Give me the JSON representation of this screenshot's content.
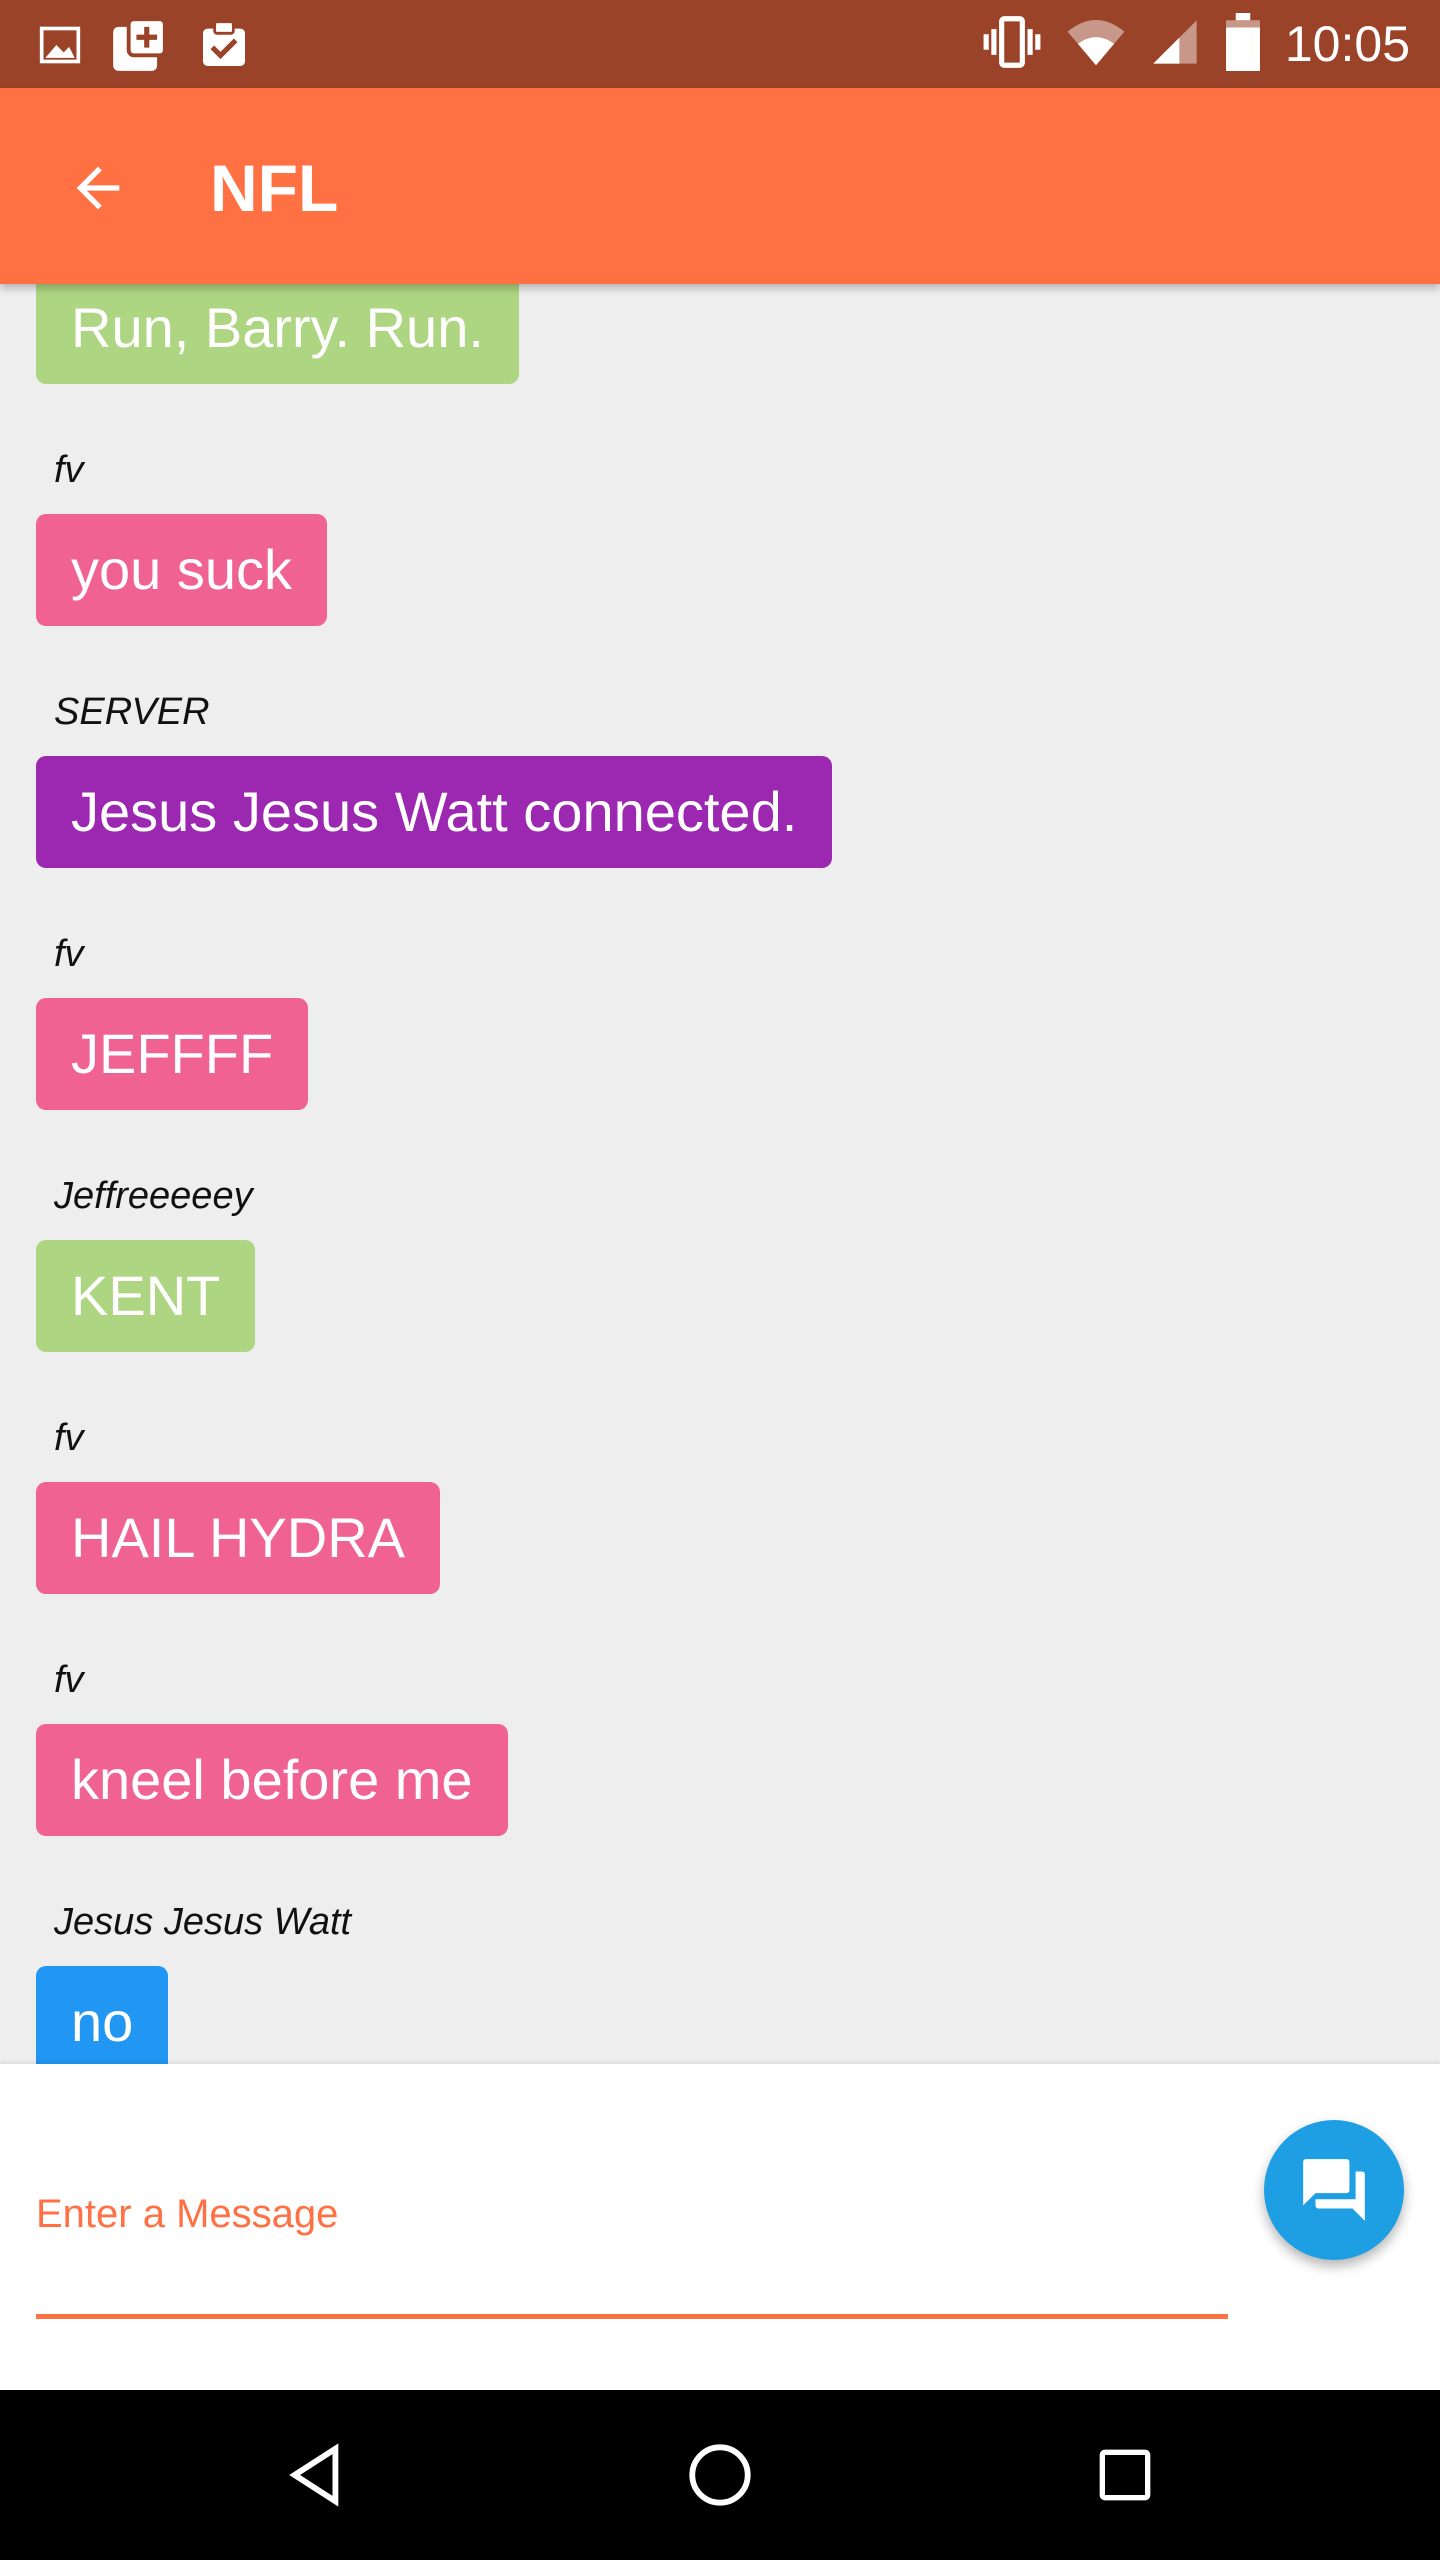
{
  "status_bar": {
    "time": "10:05",
    "left_icons": [
      "image-icon",
      "photos-plus-icon",
      "clipboard-check-icon"
    ],
    "right_icons": [
      "vibrate-icon",
      "wifi-icon",
      "signal-icon",
      "battery-icon"
    ]
  },
  "toolbar": {
    "title": "NFL",
    "back_icon": "arrow-back-icon",
    "color": "#ff7043"
  },
  "messages": [
    {
      "sender": "",
      "text": "Run, Barry. Run.",
      "color": "#aed581"
    },
    {
      "sender": "fv",
      "text": "you suck",
      "color": "#f06292"
    },
    {
      "sender": "SERVER",
      "text": "Jesus Jesus Watt connected.",
      "color": "#9c27b0"
    },
    {
      "sender": "fv",
      "text": "JEFFFF",
      "color": "#f06292"
    },
    {
      "sender": "Jeffreeeeey",
      "text": "KENT",
      "color": "#aed581"
    },
    {
      "sender": "fv",
      "text": "HAIL HYDRA",
      "color": "#f06292"
    },
    {
      "sender": "fv",
      "text": "kneel before me",
      "color": "#f06292"
    },
    {
      "sender": "Jesus Jesus Watt",
      "text": "no",
      "color": "#2196f3"
    }
  ],
  "composer": {
    "placeholder": "Enter a Message",
    "send_icon": "chat-bubbles-icon",
    "fab_color": "#1e9ee3"
  },
  "nav_bar": {
    "buttons": [
      "back-triangle-icon",
      "home-circle-icon",
      "recents-square-icon"
    ]
  }
}
